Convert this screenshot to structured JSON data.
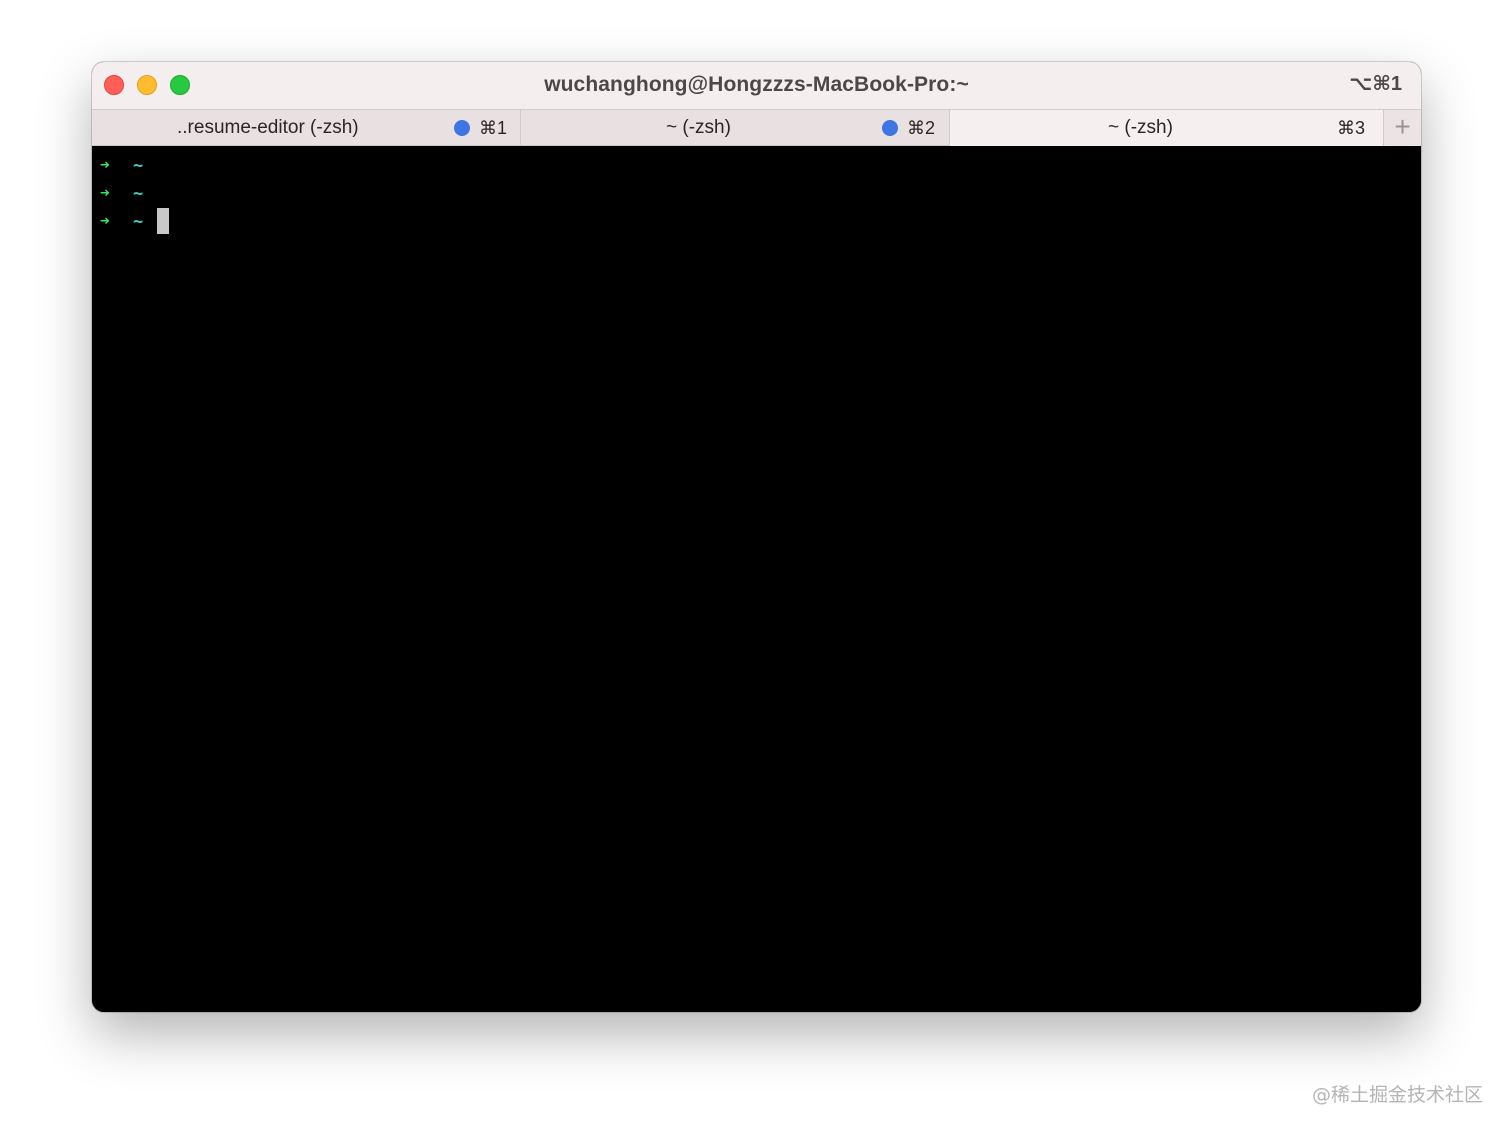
{
  "window": {
    "title": "wuchanghong@Hongzzzs-MacBook-Pro:~",
    "shortcut": "⌥⌘1"
  },
  "tabs": [
    {
      "label": "..resume-editor (-zsh)",
      "has_activity_dot": true,
      "shortcut": "⌘1",
      "active": false
    },
    {
      "label": "~ (-zsh)",
      "has_activity_dot": true,
      "shortcut": "⌘2",
      "active": false
    },
    {
      "label": "~ (-zsh)",
      "has_activity_dot": false,
      "shortcut": "⌘3",
      "active": true
    }
  ],
  "new_tab_label": "+",
  "terminal": {
    "lines": [
      {
        "arrow": "➜",
        "dir": "~"
      },
      {
        "arrow": "➜",
        "dir": "~"
      },
      {
        "arrow": "➜",
        "dir": "~",
        "cursor": true
      }
    ]
  },
  "watermark": "@稀土掘金技术社区",
  "colors": {
    "prompt_arrow": "#33e85a",
    "prompt_dir": "#3ad6c8",
    "activity_dot": "#3d74e6",
    "close": "#ff5f57",
    "minimize": "#febc2e",
    "zoom": "#28c840"
  },
  "icons": {
    "close": "close-button-icon",
    "minimize": "minimize-button-icon",
    "zoom": "zoom-button-icon",
    "new_tab": "plus-icon"
  }
}
